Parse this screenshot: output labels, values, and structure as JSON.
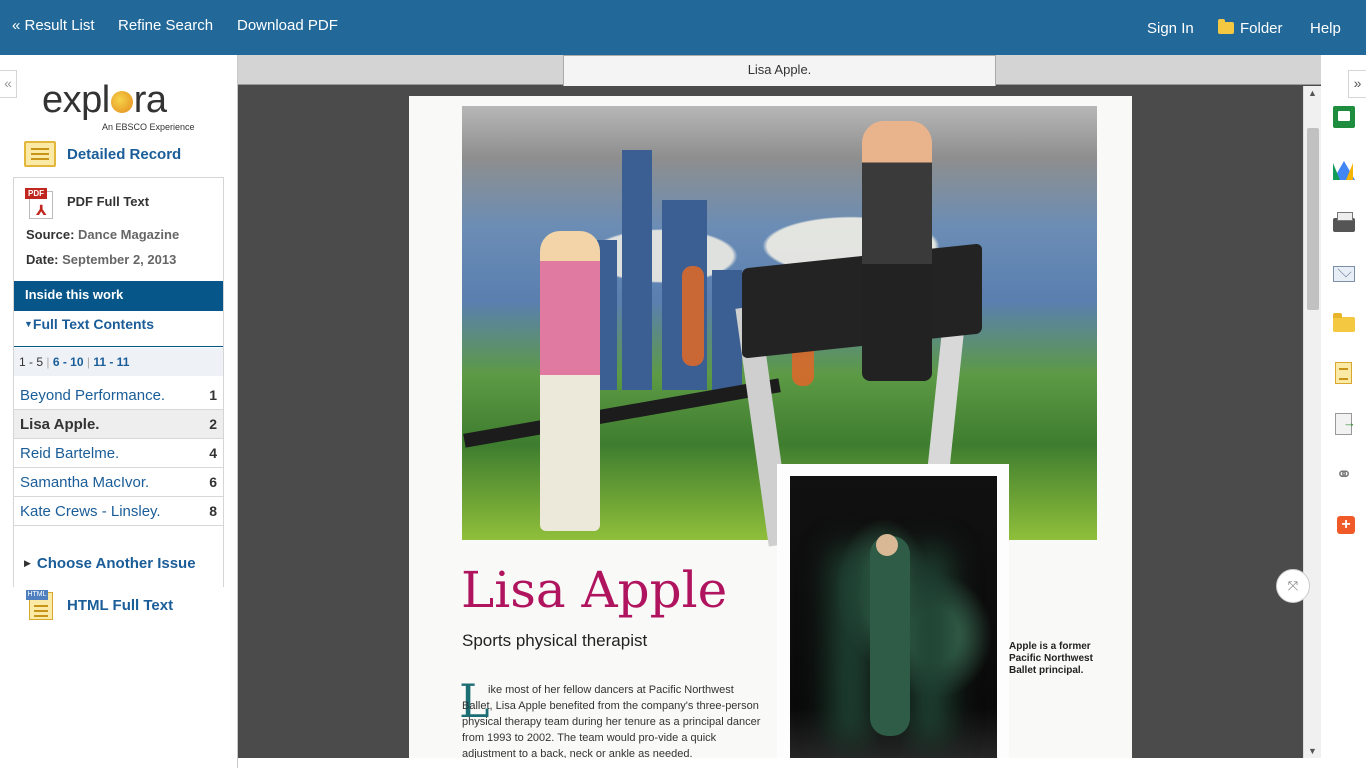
{
  "topnav": {
    "result_list": "« Result List",
    "refine_search": "Refine Search",
    "download_pdf": "Download PDF",
    "sign_in": "Sign In",
    "folder": "Folder",
    "help": "Help"
  },
  "sidebar": {
    "collapse_glyph": "«",
    "logo_text_left": "expl",
    "logo_text_right": "ra",
    "logo_subtitle": "An EBSCO Experience",
    "detailed_record": "Detailed Record",
    "pdf_full_text": "PDF Full Text",
    "pdf_tag": "PDF",
    "source_label": "Source:",
    "source_value": "Dance Magazine",
    "date_label": "Date:",
    "date_value": "September 2, 2013",
    "inside_title": "Inside this work",
    "full_text_contents": "Full Text Contents",
    "pager": {
      "p1": "1 - 5",
      "p2": "6 - 10",
      "p3": "11 - 11"
    },
    "toc": [
      {
        "title": "Beyond Performance.",
        "page": "1"
      },
      {
        "title": "Lisa Apple.",
        "page": "2"
      },
      {
        "title": "Reid Bartelme.",
        "page": "4"
      },
      {
        "title": "Samantha MacIvor.",
        "page": "6"
      },
      {
        "title": "Kate Crews - Linsley.",
        "page": "8"
      }
    ],
    "choose_another_issue": "Choose Another Issue",
    "html_full_text": "HTML Full Text",
    "html_tag": "HTML"
  },
  "viewer": {
    "tab_title": "Lisa Apple.",
    "article": {
      "headline": "Lisa Apple",
      "subtitle": "Sports physical therapist",
      "dropcap": "L",
      "body": "ike most of her fellow dancers at Pacific Northwest Ballet, Lisa Apple benefited from the company's three-person physical therapy team during her tenure as a principal dancer from 1993 to 2002. The team would pro-vide a quick adjustment to a back, neck or ankle as needed.",
      "caption": "Apple is a former Pacific Northwest Ballet principal."
    }
  },
  "tools": {
    "collapse_glyph": "»",
    "items": [
      "google-classroom-icon",
      "google-drive-icon",
      "print-icon",
      "email-icon",
      "folder-icon",
      "cite-icon",
      "export-icon",
      "permalink-icon",
      "share-icon"
    ]
  },
  "colors": {
    "topbar": "#22699a",
    "link": "#1a5d98",
    "inside_header": "#06568a",
    "headline": "#b0145f"
  }
}
